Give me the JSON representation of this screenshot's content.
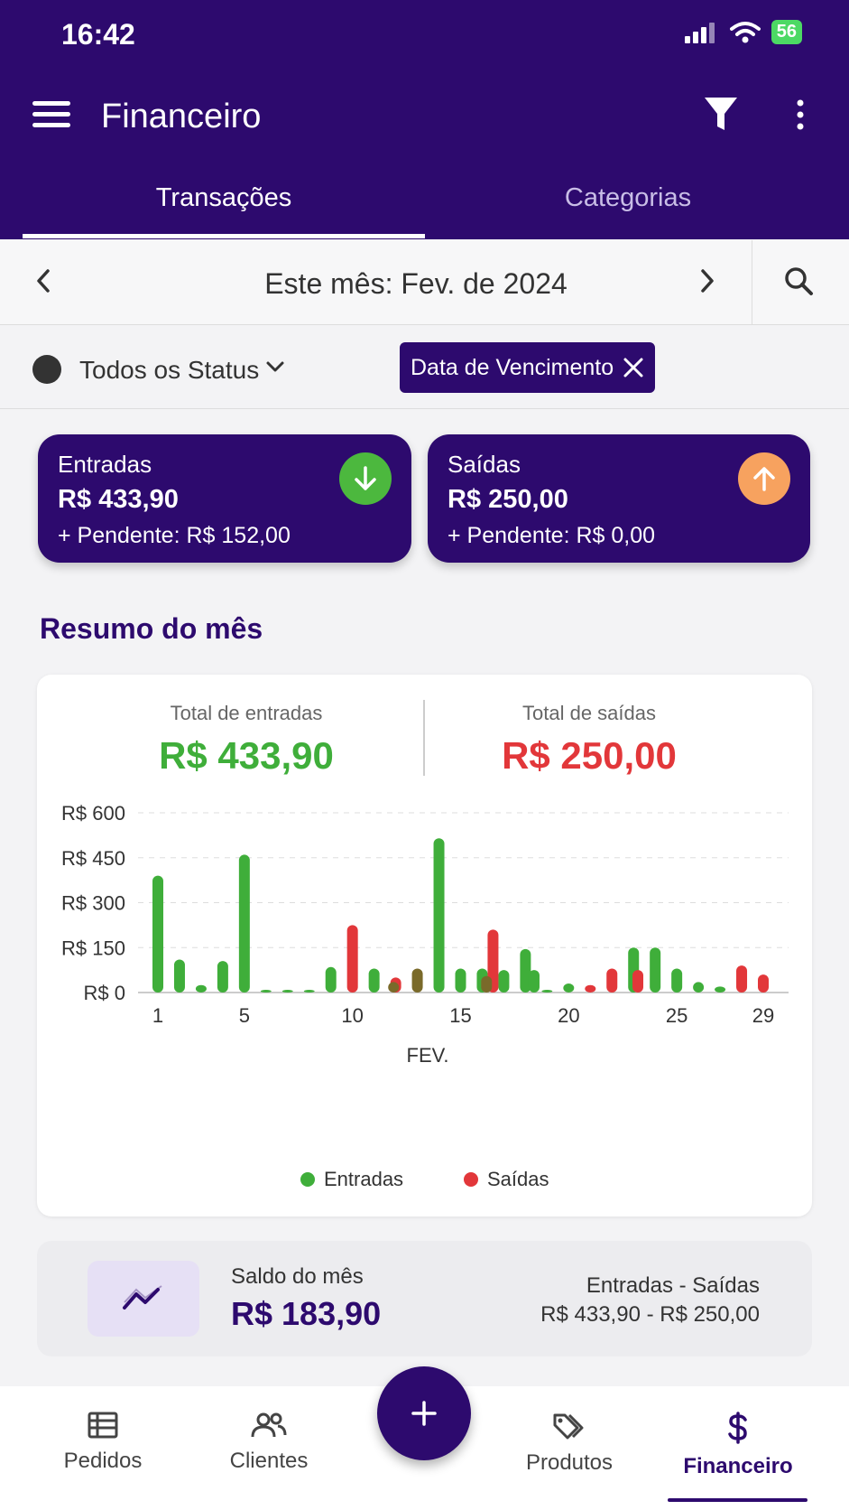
{
  "status_bar": {
    "time": "16:42",
    "battery": "56"
  },
  "app_bar": {
    "title": "Financeiro"
  },
  "tabs": [
    {
      "label": "Transações",
      "active": true
    },
    {
      "label": "Categorias",
      "active": false
    }
  ],
  "date_nav": {
    "label": "Este mês: Fev. de 2024"
  },
  "filters": {
    "status_label": "Todos os Status",
    "chip_label": "Data de Vencimento"
  },
  "summary_cards": {
    "income": {
      "title": "Entradas",
      "amount": "R$ 433,90",
      "pending": "+ Pendente: R$ 152,00",
      "icon": "arrow-down-icon",
      "color": "#4cb83e"
    },
    "expense": {
      "title": "Saídas",
      "amount": "R$ 250,00",
      "pending": "+ Pendente: R$ 0,00",
      "icon": "arrow-up-icon",
      "color": "#f7a25f"
    }
  },
  "month_summary": {
    "title": "Resumo do mês",
    "total_in_label": "Total de entradas",
    "total_in_value": "R$ 433,90",
    "total_out_label": "Total de saídas",
    "total_out_value": "R$ 250,00"
  },
  "chart_data": {
    "type": "bar",
    "xlabel": "FEV.",
    "ylabel": "",
    "ylim": [
      0,
      600
    ],
    "yticks": [
      "R$ 0",
      "R$ 150",
      "R$ 300",
      "R$ 450",
      "R$ 600"
    ],
    "ytick_values": [
      0,
      150,
      300,
      450,
      600
    ],
    "xticks": [
      "1",
      "5",
      "10",
      "15",
      "20",
      "25",
      "29"
    ],
    "xtick_values": [
      1,
      5,
      10,
      15,
      20,
      25,
      29
    ],
    "xlim": [
      1,
      29
    ],
    "grid": true,
    "legend_position": "bottom",
    "series": [
      {
        "name": "Entradas",
        "color": "#3fae3a",
        "points": [
          [
            1,
            390
          ],
          [
            2,
            110
          ],
          [
            3,
            25
          ],
          [
            4,
            105
          ],
          [
            5,
            460
          ],
          [
            6,
            5
          ],
          [
            7,
            5
          ],
          [
            8,
            5
          ],
          [
            9,
            85
          ],
          [
            11,
            80
          ],
          [
            14,
            515
          ],
          [
            15,
            80
          ],
          [
            16,
            80
          ],
          [
            17,
            75
          ],
          [
            18,
            145
          ],
          [
            18.4,
            75
          ],
          [
            19,
            5
          ],
          [
            20,
            30
          ],
          [
            23,
            150
          ],
          [
            24,
            150
          ],
          [
            25,
            80
          ],
          [
            26,
            35
          ],
          [
            27,
            20
          ]
        ]
      },
      {
        "name": "Saídas",
        "color": "#e2373a",
        "points": [
          [
            10,
            225
          ],
          [
            12,
            50
          ],
          [
            16.5,
            210
          ],
          [
            21,
            25
          ],
          [
            22,
            80
          ],
          [
            23.2,
            75
          ],
          [
            28,
            90
          ],
          [
            29,
            60
          ]
        ]
      },
      {
        "name": "",
        "color": "#7a6a2a",
        "points": [
          [
            11.9,
            35
          ],
          [
            13,
            80
          ],
          [
            16.2,
            55
          ]
        ]
      }
    ]
  },
  "balance": {
    "label": "Saldo do mês",
    "value": "R$ 183,90",
    "formula_label": "Entradas - Saídas",
    "formula_value": "R$ 433,90 - R$ 250,00"
  },
  "bottom_nav": [
    {
      "label": "Pedidos",
      "icon": "list-icon",
      "active": false
    },
    {
      "label": "Clientes",
      "icon": "people-icon",
      "active": false
    },
    {
      "label": "Produtos",
      "icon": "tags-icon",
      "active": false
    },
    {
      "label": "Financeiro",
      "icon": "dollar-icon",
      "active": true
    }
  ],
  "colors": {
    "primary": "#2d0a6e",
    "income": "#3fae3a",
    "expense": "#e2373a"
  }
}
